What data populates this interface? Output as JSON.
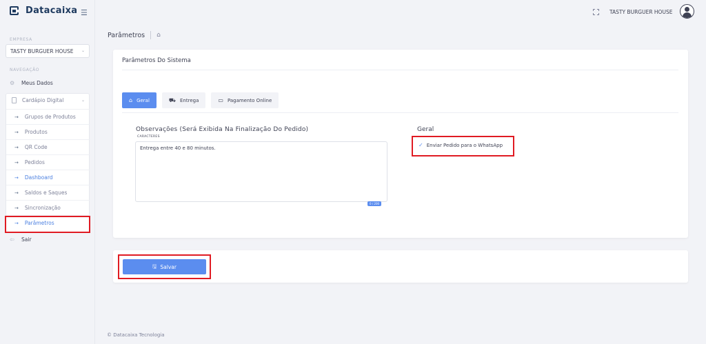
{
  "brand": {
    "name": "Datacaixa",
    "logo_icon": "datacaixa-logo-icon",
    "menu_icon": "hamburger-icon"
  },
  "sidebar": {
    "company_label": "EMPRESA",
    "company_select": "TASTY BURGUER HOUSE",
    "nav_label": "NAVEGAÇÃO",
    "meus_dados": "Meus Dados",
    "cardapio": "Cardápio Digital",
    "sub_items": [
      {
        "label": "Grupos de Produtos"
      },
      {
        "label": "Produtos"
      },
      {
        "label": "QR Code"
      },
      {
        "label": "Pedidos"
      },
      {
        "label": "Dashboard"
      },
      {
        "label": "Saldos e Saques"
      },
      {
        "label": "Sincronização"
      },
      {
        "label": "Parâmetros"
      }
    ],
    "sair": "Sair"
  },
  "topbar": {
    "company": "TASTY BURGUER HOUSE"
  },
  "breadcrumb": {
    "title": "Parâmetros"
  },
  "card": {
    "title": "Parâmetros Do Sistema",
    "tabs": [
      {
        "label": "Geral",
        "icon": "home-icon"
      },
      {
        "label": "Entrega",
        "icon": "truck-icon"
      },
      {
        "label": "Pagamento Online",
        "icon": "credit-card-icon"
      }
    ],
    "obs_title": "Observações (Será Exibida Na Finalização Do Pedido)",
    "obs_subtitle": "CARACTERES",
    "obs_value": "Entrega entre 40 e 80 minutos.",
    "counter": "0 / 200",
    "geral_title": "Geral",
    "whatsapp_label": "Enviar Pedido para o WhatsApp",
    "whatsapp_checked": true
  },
  "save": {
    "label": "Salvar"
  },
  "footer": {
    "text": "© Datacaixa Tecnologia"
  },
  "colors": {
    "accent": "#5b8def",
    "highlight": "#e01a22",
    "brand": "#1e3a5f",
    "background": "#f2f3f7"
  }
}
